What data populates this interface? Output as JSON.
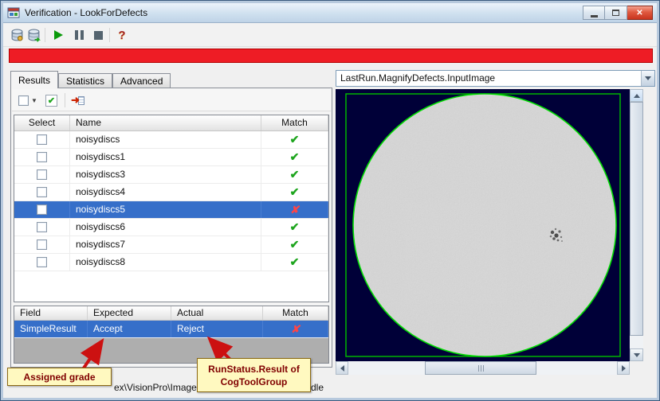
{
  "window": {
    "title": "Verification - LookForDefects"
  },
  "toolbar": {
    "icons": [
      "database-icon",
      "database-link-icon",
      "play-icon",
      "pause-icon",
      "stop-icon",
      "help-icon"
    ]
  },
  "alert_bar": {
    "color": "#ee1c25"
  },
  "tabs": [
    {
      "label": "Results",
      "active": true
    },
    {
      "label": "Statistics",
      "active": false
    },
    {
      "label": "Advanced",
      "active": false
    }
  ],
  "results_toolbar": {
    "icons": [
      "checkbox-dropdown-icon",
      "checked-box-icon",
      "export-to-grid-icon"
    ]
  },
  "results_table": {
    "columns": {
      "select": "Select",
      "name": "Name",
      "match": "Match"
    },
    "rows": [
      {
        "name": "noisydiscs",
        "checked": false,
        "match": "pass",
        "selected": false
      },
      {
        "name": "noisydiscs1",
        "checked": false,
        "match": "pass",
        "selected": false
      },
      {
        "name": "noisydiscs3",
        "checked": false,
        "match": "pass",
        "selected": false
      },
      {
        "name": "noisydiscs4",
        "checked": false,
        "match": "pass",
        "selected": false
      },
      {
        "name": "noisydiscs5",
        "checked": false,
        "match": "fail",
        "selected": true
      },
      {
        "name": "noisydiscs6",
        "checked": false,
        "match": "pass",
        "selected": false
      },
      {
        "name": "noisydiscs7",
        "checked": false,
        "match": "pass",
        "selected": false
      },
      {
        "name": "noisydiscs8",
        "checked": false,
        "match": "pass",
        "selected": false
      }
    ]
  },
  "detail_table": {
    "columns": {
      "field": "Field",
      "expected": "Expected",
      "actual": "Actual",
      "match": "Match"
    },
    "rows": [
      {
        "field": "SimpleResult",
        "expected": "Accept",
        "actual": "Reject",
        "match": "fail",
        "selected": true
      }
    ]
  },
  "icons": {
    "pass_glyph": "✔",
    "fail_glyph": "✘"
  },
  "callouts": {
    "assigned_grade": "Assigned grade",
    "runstatus": [
      "RunStatus.Result of",
      "CogToolGroup"
    ]
  },
  "status_bar": {
    "path_fragment": "ex\\VisionPro\\Images",
    "idle_fragment": "dle"
  },
  "image_panel": {
    "selected_image": "LastRun.MagnifyDefects.InputImage",
    "colors": {
      "background": "#000038",
      "outline": "#00cc00",
      "disc": "#d7d7d7"
    }
  }
}
